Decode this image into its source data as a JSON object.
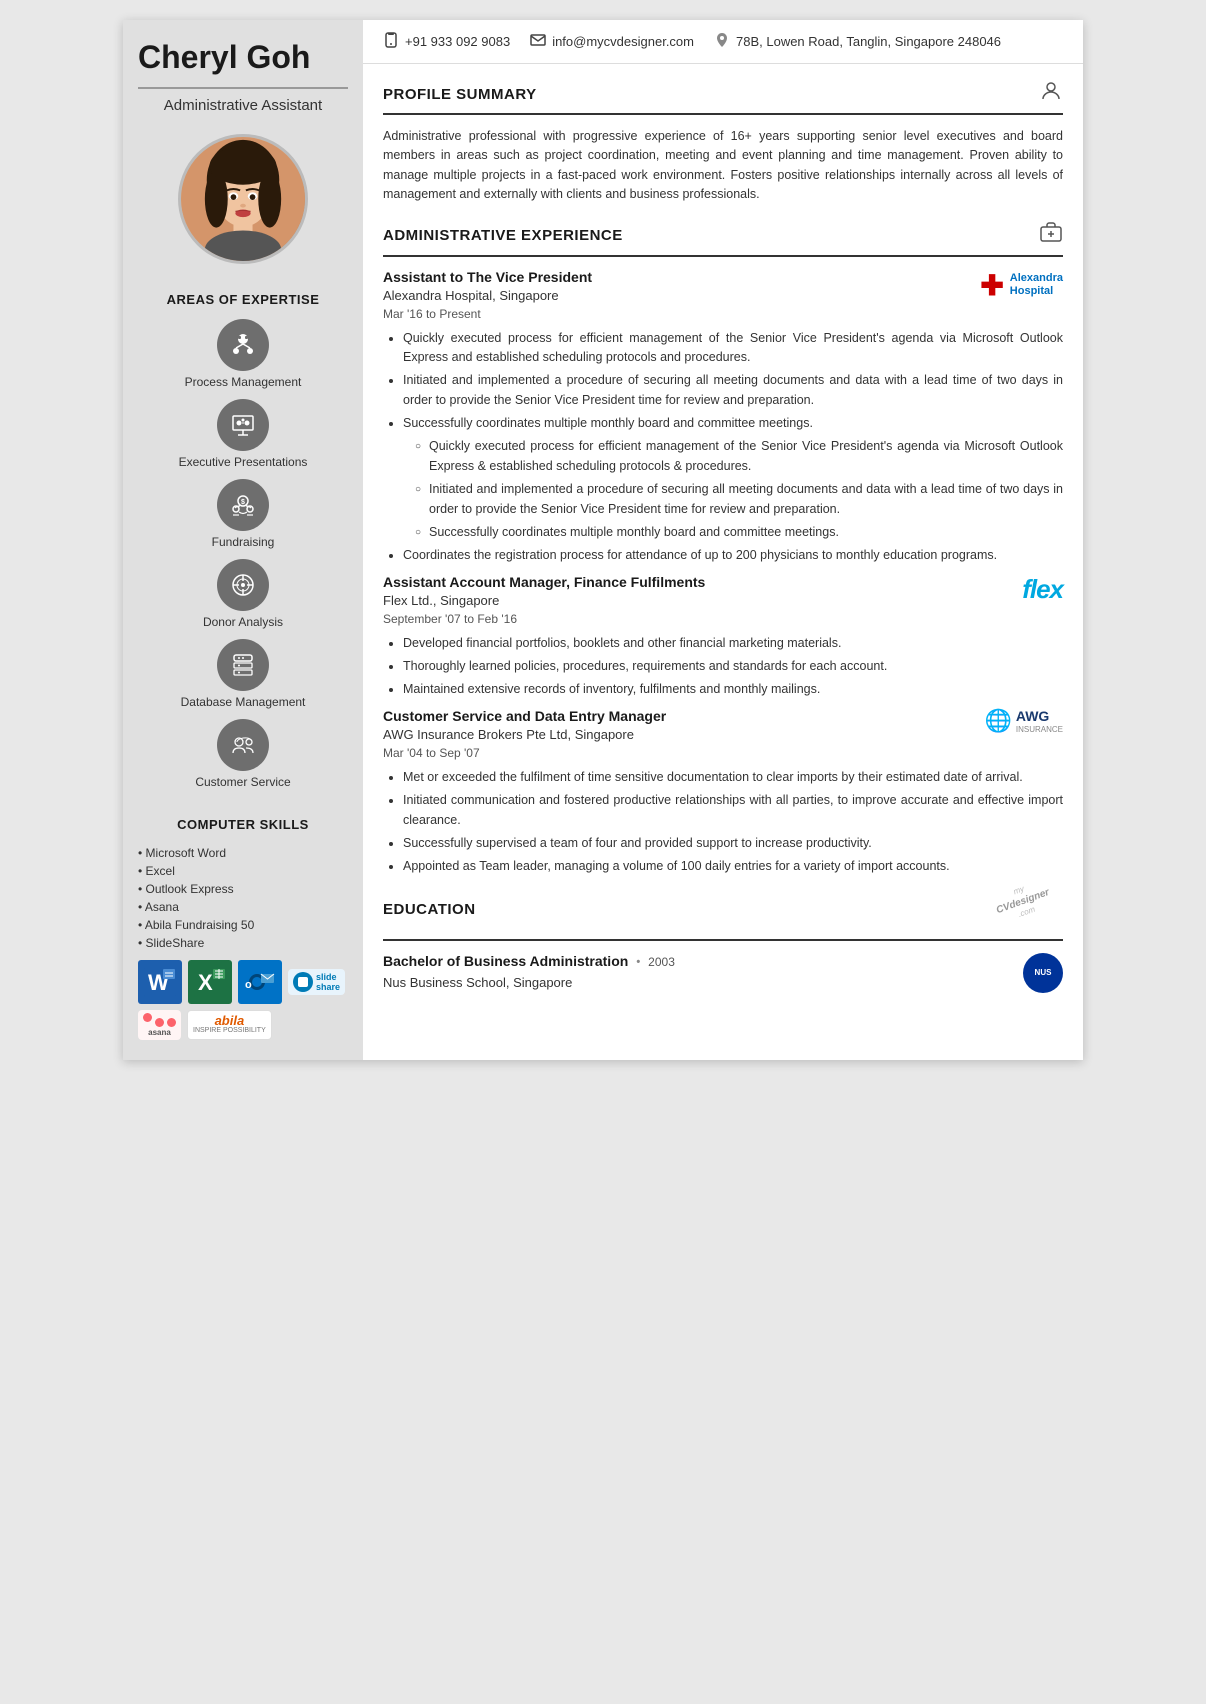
{
  "sidebar": {
    "name": "Cheryl Goh",
    "title": "Administrative Assistant",
    "sections": {
      "expertise": {
        "heading": "AREAS OF EXPERTISE",
        "items": [
          {
            "label": "Process Management",
            "icon": "process"
          },
          {
            "label": "Executive Presentations",
            "icon": "presentation"
          },
          {
            "label": "Fundraising",
            "icon": "fundraising"
          },
          {
            "label": "Donor Analysis",
            "icon": "donor"
          },
          {
            "label": "Database Management",
            "icon": "database"
          },
          {
            "label": "Customer Service",
            "icon": "service"
          }
        ]
      },
      "computer_skills": {
        "heading": "COMPUTER SKILLS",
        "skills": [
          "Microsoft Word",
          "Excel",
          "Outlook Express",
          "Asana",
          "Abila Fundraising 50",
          "SlideShare"
        ]
      }
    }
  },
  "contact": {
    "phone": "+91 933 092 9083",
    "email": "info@mycvdesigner.com",
    "address": "78B, Lowen Road, Tanglin, Singapore 248046"
  },
  "profile_summary": {
    "heading": "PROFILE SUMMARY",
    "text": "Administrative professional with progressive experience of 16+ years supporting senior level executives and board members in areas such as project coordination, meeting and event planning and time management. Proven ability to manage multiple projects in a fast-paced work environment. Fosters positive relationships internally across all levels of management and externally with clients and business professionals."
  },
  "experience": {
    "heading": "ADMINISTRATIVE EXPERIENCE",
    "jobs": [
      {
        "title": "Assistant to The Vice President",
        "company": "Alexandra Hospital, Singapore",
        "dates": "Mar '16 to Present",
        "company_logo": "Alexandra Hospital",
        "bullets": [
          "Quickly executed process for efficient management of the Senior Vice President's agenda via Microsoft Outlook Express and established scheduling protocols and procedures.",
          "Initiated and implemented a procedure of securing all meeting documents and data with a lead time of two days in order to provide the Senior Vice President time for review and preparation.",
          "Successfully coordinates multiple monthly board and committee meetings."
        ],
        "sub_bullets": [
          "Quickly executed process for efficient management of the Senior Vice President's agenda via Microsoft Outlook Express & established scheduling protocols & procedures.",
          "Initiated and implemented a procedure of securing all meeting documents and data with a lead time of two days in order to provide the Senior Vice President time for review and preparation.",
          "Successfully coordinates multiple monthly board and committee meetings."
        ],
        "extra_bullet": "Coordinates the registration process for attendance of up to 200 physicians to monthly education programs."
      },
      {
        "title": "Assistant Account Manager, Finance Fulfilments",
        "company": "Flex Ltd., Singapore",
        "dates": "September '07 to Feb '16",
        "company_logo": "flex",
        "bullets": [
          "Developed financial portfolios, booklets and other financial marketing materials.",
          "Thoroughly learned policies, procedures, requirements and standards for each account.",
          "Maintained extensive records of inventory, fulfilments and monthly mailings."
        ]
      },
      {
        "title": "Customer Service and Data Entry Manager",
        "company": "AWG Insurance Brokers Pte Ltd, Singapore",
        "dates": "Mar '04 to Sep '07",
        "company_logo": "AWG",
        "bullets": [
          "Met or exceeded the fulfilment of time sensitive documentation to clear imports by their estimated date of arrival.",
          "Initiated communication and fostered productive relationships with all parties, to improve accurate and effective import clearance.",
          "Successfully supervised a team of four and provided support to increase productivity.",
          "Appointed as Team leader, managing a volume of 100 daily entries for a variety of import accounts."
        ]
      }
    ]
  },
  "education": {
    "heading": "EDUCATION",
    "degree": "Bachelor of Business Administration",
    "year": "2003",
    "school": "Nus Business School, Singapore"
  }
}
